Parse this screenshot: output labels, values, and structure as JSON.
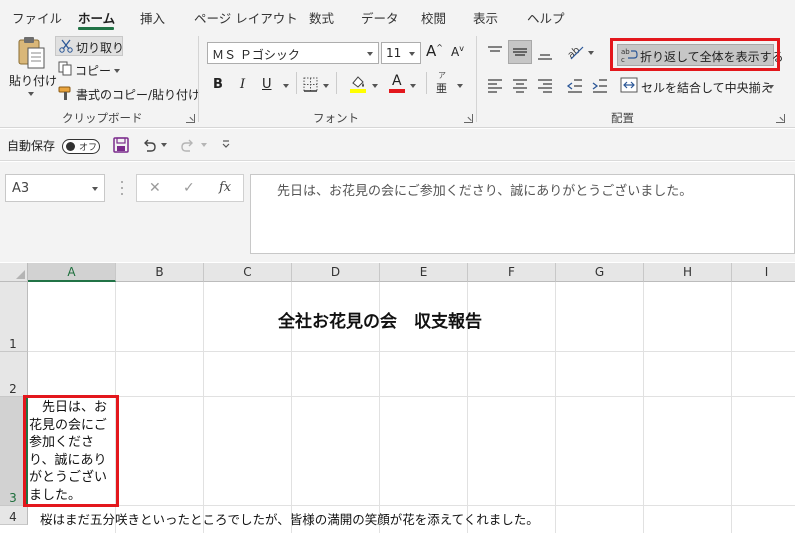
{
  "ribbon": {
    "tabs": [
      "ファイル",
      "ホーム",
      "挿入",
      "ページ レイアウト",
      "数式",
      "データ",
      "校閲",
      "表示",
      "ヘルプ"
    ],
    "active_tab": "ホーム",
    "clipboard": {
      "paste_label": "貼り付け",
      "cut_label": "切り取り",
      "copy_label": "コピー",
      "format_painter_label": "書式のコピー/貼り付け",
      "group_label": "クリップボード"
    },
    "font": {
      "font_name": "ＭＳ Ｐゴシック",
      "font_size": "11",
      "bold": "B",
      "italic": "I",
      "underline": "U",
      "group_label": "フォント",
      "highlight_color": "#ffff00",
      "font_color": "#e3171c"
    },
    "alignment": {
      "wrap_text_label": "折り返して全体を表示する",
      "merge_center_label": "セルを結合して中央揃え",
      "group_label": "配置"
    }
  },
  "qat": {
    "autosave_label": "自動保存",
    "autosave_state": "オフ"
  },
  "formula_bar": {
    "name_box": "A3",
    "cancel_symbol": "✕",
    "enter_symbol": "✓",
    "fx_symbol": "fx",
    "formula": "先日は、お花見の会にご参加くださり、誠にありがとうございました。"
  },
  "sheet": {
    "columns": [
      "A",
      "B",
      "C",
      "D",
      "E",
      "F",
      "G",
      "H",
      "I"
    ],
    "rows": [
      "1",
      "2",
      "3",
      "4"
    ],
    "selected_cell": "A3",
    "title": "全社お花見の会　収支報告",
    "a3_text": "　先日は、お花見の会にご参加くださり、誠にありがとうございました。",
    "a4_text": "桜はまだ五分咲きといったところでしたが、皆様の満開の笑顔が花を添えてくれました。"
  },
  "colors": {
    "accent_green": "#217346",
    "highlight_red": "#e3171c"
  }
}
